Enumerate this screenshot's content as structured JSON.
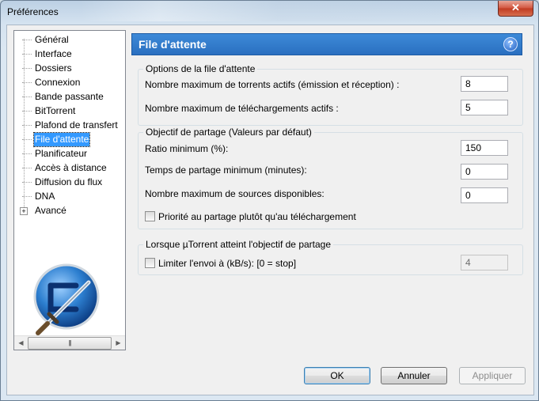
{
  "window": {
    "title": "Préférences",
    "close_glyph": "✕"
  },
  "sidebar": {
    "items": [
      {
        "label": "Général"
      },
      {
        "label": "Interface"
      },
      {
        "label": "Dossiers"
      },
      {
        "label": "Connexion"
      },
      {
        "label": "Bande passante"
      },
      {
        "label": "BitTorrent"
      },
      {
        "label": "Plafond de transfert"
      },
      {
        "label": "File d'attente",
        "selected": true
      },
      {
        "label": "Planificateur"
      },
      {
        "label": "Accès à distance"
      },
      {
        "label": "Diffusion du flux"
      },
      {
        "label": "DNA"
      },
      {
        "label": "Avancé",
        "expandable": true
      }
    ],
    "expander_glyph": "+",
    "scroll_thumb_glyph": "|||"
  },
  "panel": {
    "title": "File d'attente",
    "help_glyph": "?",
    "queue_group": {
      "title": "Options de la file d'attente",
      "max_active_torrents_label": "Nombre maximum de torrents actifs (émission et réception) :",
      "max_active_torrents_value": "8",
      "max_active_downloads_label": "Nombre maximum de téléchargements actifs :",
      "max_active_downloads_value": "5"
    },
    "seed_group": {
      "title": "Objectif de partage (Valeurs par défaut)",
      "min_ratio_label": "Ratio minimum (%):",
      "min_ratio_value": "150",
      "min_seed_time_label": "Temps de partage minimum (minutes):",
      "min_seed_time_value": "0",
      "max_sources_label": "Nombre maximum de sources disponibles:",
      "max_sources_value": "0",
      "priority_checkbox_label": "Priorité au partage plutôt qu'au téléchargement",
      "priority_checked": false
    },
    "goal_group": {
      "title": "Lorsque µTorrent atteint l'objectif de partage",
      "limit_upload_label": "Limiter l'envoi à (kB/s): [0 = stop]",
      "limit_upload_checked": false,
      "limit_upload_value": "4"
    }
  },
  "buttons": {
    "ok": "OK",
    "cancel": "Annuler",
    "apply": "Appliquer"
  }
}
